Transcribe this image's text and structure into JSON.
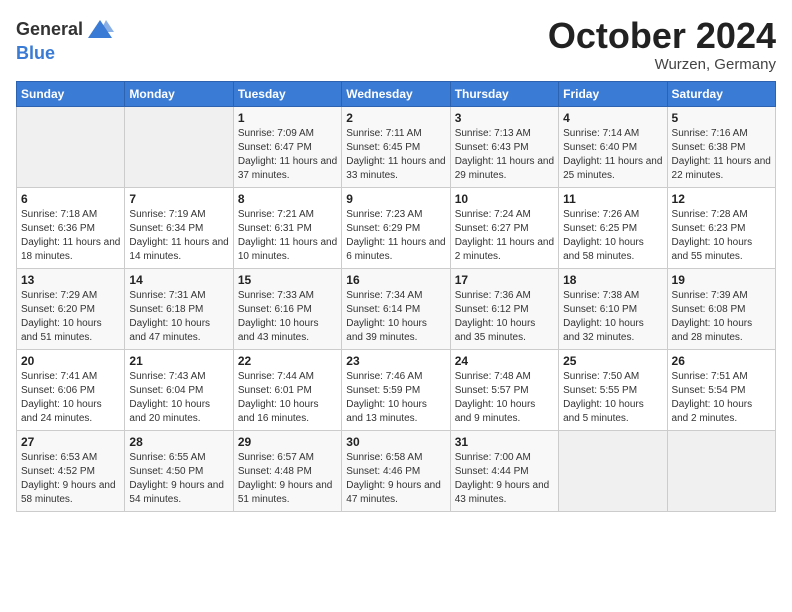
{
  "logo": {
    "general": "General",
    "blue": "Blue"
  },
  "header": {
    "month": "October 2024",
    "location": "Wurzen, Germany"
  },
  "weekdays": [
    "Sunday",
    "Monday",
    "Tuesday",
    "Wednesday",
    "Thursday",
    "Friday",
    "Saturday"
  ],
  "weeks": [
    [
      {
        "day": "",
        "detail": ""
      },
      {
        "day": "",
        "detail": ""
      },
      {
        "day": "1",
        "detail": "Sunrise: 7:09 AM\nSunset: 6:47 PM\nDaylight: 11 hours and 37 minutes."
      },
      {
        "day": "2",
        "detail": "Sunrise: 7:11 AM\nSunset: 6:45 PM\nDaylight: 11 hours and 33 minutes."
      },
      {
        "day": "3",
        "detail": "Sunrise: 7:13 AM\nSunset: 6:43 PM\nDaylight: 11 hours and 29 minutes."
      },
      {
        "day": "4",
        "detail": "Sunrise: 7:14 AM\nSunset: 6:40 PM\nDaylight: 11 hours and 25 minutes."
      },
      {
        "day": "5",
        "detail": "Sunrise: 7:16 AM\nSunset: 6:38 PM\nDaylight: 11 hours and 22 minutes."
      }
    ],
    [
      {
        "day": "6",
        "detail": "Sunrise: 7:18 AM\nSunset: 6:36 PM\nDaylight: 11 hours and 18 minutes."
      },
      {
        "day": "7",
        "detail": "Sunrise: 7:19 AM\nSunset: 6:34 PM\nDaylight: 11 hours and 14 minutes."
      },
      {
        "day": "8",
        "detail": "Sunrise: 7:21 AM\nSunset: 6:31 PM\nDaylight: 11 hours and 10 minutes."
      },
      {
        "day": "9",
        "detail": "Sunrise: 7:23 AM\nSunset: 6:29 PM\nDaylight: 11 hours and 6 minutes."
      },
      {
        "day": "10",
        "detail": "Sunrise: 7:24 AM\nSunset: 6:27 PM\nDaylight: 11 hours and 2 minutes."
      },
      {
        "day": "11",
        "detail": "Sunrise: 7:26 AM\nSunset: 6:25 PM\nDaylight: 10 hours and 58 minutes."
      },
      {
        "day": "12",
        "detail": "Sunrise: 7:28 AM\nSunset: 6:23 PM\nDaylight: 10 hours and 55 minutes."
      }
    ],
    [
      {
        "day": "13",
        "detail": "Sunrise: 7:29 AM\nSunset: 6:20 PM\nDaylight: 10 hours and 51 minutes."
      },
      {
        "day": "14",
        "detail": "Sunrise: 7:31 AM\nSunset: 6:18 PM\nDaylight: 10 hours and 47 minutes."
      },
      {
        "day": "15",
        "detail": "Sunrise: 7:33 AM\nSunset: 6:16 PM\nDaylight: 10 hours and 43 minutes."
      },
      {
        "day": "16",
        "detail": "Sunrise: 7:34 AM\nSunset: 6:14 PM\nDaylight: 10 hours and 39 minutes."
      },
      {
        "day": "17",
        "detail": "Sunrise: 7:36 AM\nSunset: 6:12 PM\nDaylight: 10 hours and 35 minutes."
      },
      {
        "day": "18",
        "detail": "Sunrise: 7:38 AM\nSunset: 6:10 PM\nDaylight: 10 hours and 32 minutes."
      },
      {
        "day": "19",
        "detail": "Sunrise: 7:39 AM\nSunset: 6:08 PM\nDaylight: 10 hours and 28 minutes."
      }
    ],
    [
      {
        "day": "20",
        "detail": "Sunrise: 7:41 AM\nSunset: 6:06 PM\nDaylight: 10 hours and 24 minutes."
      },
      {
        "day": "21",
        "detail": "Sunrise: 7:43 AM\nSunset: 6:04 PM\nDaylight: 10 hours and 20 minutes."
      },
      {
        "day": "22",
        "detail": "Sunrise: 7:44 AM\nSunset: 6:01 PM\nDaylight: 10 hours and 16 minutes."
      },
      {
        "day": "23",
        "detail": "Sunrise: 7:46 AM\nSunset: 5:59 PM\nDaylight: 10 hours and 13 minutes."
      },
      {
        "day": "24",
        "detail": "Sunrise: 7:48 AM\nSunset: 5:57 PM\nDaylight: 10 hours and 9 minutes."
      },
      {
        "day": "25",
        "detail": "Sunrise: 7:50 AM\nSunset: 5:55 PM\nDaylight: 10 hours and 5 minutes."
      },
      {
        "day": "26",
        "detail": "Sunrise: 7:51 AM\nSunset: 5:54 PM\nDaylight: 10 hours and 2 minutes."
      }
    ],
    [
      {
        "day": "27",
        "detail": "Sunrise: 6:53 AM\nSunset: 4:52 PM\nDaylight: 9 hours and 58 minutes."
      },
      {
        "day": "28",
        "detail": "Sunrise: 6:55 AM\nSunset: 4:50 PM\nDaylight: 9 hours and 54 minutes."
      },
      {
        "day": "29",
        "detail": "Sunrise: 6:57 AM\nSunset: 4:48 PM\nDaylight: 9 hours and 51 minutes."
      },
      {
        "day": "30",
        "detail": "Sunrise: 6:58 AM\nSunset: 4:46 PM\nDaylight: 9 hours and 47 minutes."
      },
      {
        "day": "31",
        "detail": "Sunrise: 7:00 AM\nSunset: 4:44 PM\nDaylight: 9 hours and 43 minutes."
      },
      {
        "day": "",
        "detail": ""
      },
      {
        "day": "",
        "detail": ""
      }
    ]
  ]
}
